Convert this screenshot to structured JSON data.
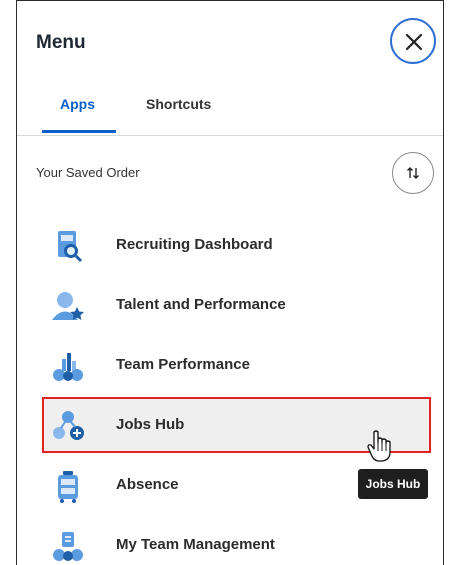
{
  "menu": {
    "title": "Menu"
  },
  "tabs": [
    {
      "label": "Apps",
      "active": true
    },
    {
      "label": "Shortcuts",
      "active": false
    }
  ],
  "saved_order": {
    "label": "Your Saved Order"
  },
  "apps": [
    {
      "label": "Recruiting Dashboard",
      "icon": "recruiting-dashboard-icon"
    },
    {
      "label": "Talent and Performance",
      "icon": "talent-performance-icon"
    },
    {
      "label": "Team Performance",
      "icon": "team-performance-icon"
    },
    {
      "label": "Jobs Hub",
      "icon": "jobs-hub-icon",
      "highlighted": true
    },
    {
      "label": "Absence",
      "icon": "absence-icon"
    },
    {
      "label": "My Team Management",
      "icon": "team-management-icon"
    }
  ],
  "tooltip": {
    "text": "Jobs Hub"
  },
  "colors": {
    "accent": "#0b5fcc",
    "highlight_border": "#e02424",
    "icon_blue": "#4a8fd6"
  }
}
